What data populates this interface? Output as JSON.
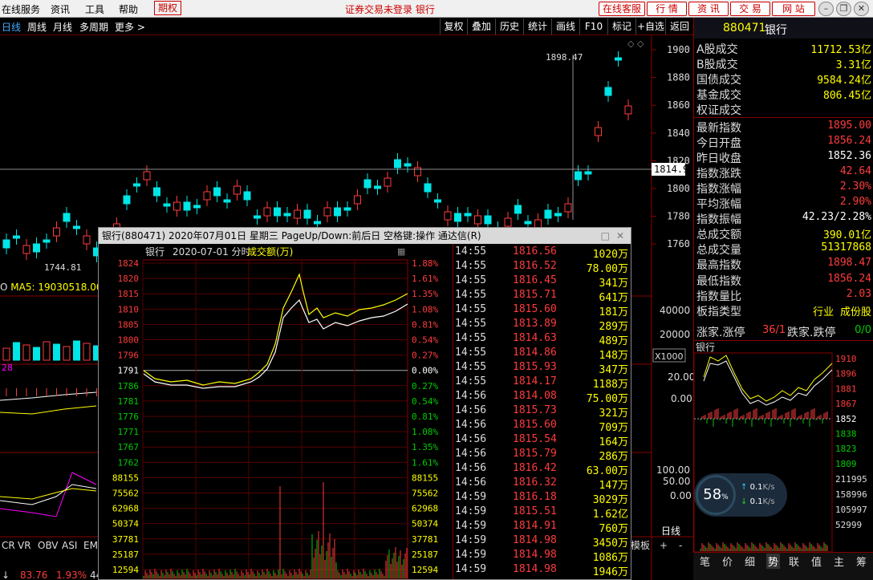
{
  "menu": {
    "items": [
      "在线服务",
      "资讯",
      "工具",
      "帮助",
      "期权"
    ],
    "center": "证券交易未登录  银行",
    "right_buttons": [
      "在线客服",
      "行 情",
      "资 讯",
      "交 易",
      "网 站"
    ]
  },
  "toolbar": {
    "left": [
      "日线",
      "周线",
      "月线",
      "多周期",
      "更多 >"
    ],
    "right": [
      "复权",
      "叠加",
      "历史",
      "统计",
      "画线",
      "F10",
      "标记",
      "+自选",
      "返回"
    ]
  },
  "main_chart": {
    "price_axis": [
      "1900",
      "1880",
      "1860",
      "1840",
      "1820",
      "1800",
      "1780",
      "1760"
    ],
    "current_price_label": "1814.9",
    "high_label": "1898.47",
    "low_label": "1744.81",
    "ma_label": "MA5: 19030518.00",
    "vol_axis": [
      "40000",
      "20000"
    ],
    "x1000_label": "X1000",
    "ind_axis": [
      "20.00",
      "0.00"
    ],
    "ind2_axis": [
      "100.00",
      "50.00",
      "0.00"
    ],
    "ind_tabs": [
      "CR",
      "VR",
      "OBV",
      "ASI",
      "EM"
    ],
    "bottom_status": [
      "83.76",
      "1.93%"
    ],
    "bottom_tabs": [
      "模板",
      "+",
      "日线",
      "-"
    ],
    "count_label": "28",
    "extra": "44"
  },
  "right_panel": {
    "code": "880471",
    "name": "银行",
    "stats": [
      {
        "k": "A股成交",
        "v": "11712.53亿",
        "c": "yel"
      },
      {
        "k": "B股成交",
        "v": "3.31亿",
        "c": "yel"
      },
      {
        "k": "国债成交",
        "v": "9584.24亿",
        "c": "yel"
      },
      {
        "k": "基金成交",
        "v": "806.45亿",
        "c": "yel"
      },
      {
        "k": "权证成交",
        "v": "",
        "c": "yel"
      },
      {
        "k": "最新指数",
        "v": "1895.00",
        "c": "red"
      },
      {
        "k": "今日开盘",
        "v": "1856.24",
        "c": "red"
      },
      {
        "k": "昨日收盘",
        "v": "1852.36",
        "c": "wht"
      },
      {
        "k": "指数涨跌",
        "v": "42.64",
        "c": "red"
      },
      {
        "k": "指数涨幅",
        "v": "2.30%",
        "c": "red"
      },
      {
        "k": "平均涨幅",
        "v": "2.90%",
        "c": "red"
      },
      {
        "k": "指数振幅",
        "v": "42.23/2.28%",
        "c": "wht"
      },
      {
        "k": "总成交额",
        "v": "390.01亿",
        "c": "yel"
      },
      {
        "k": "总成交量",
        "v": "51317868",
        "c": "yel"
      },
      {
        "k": "最高指数",
        "v": "1898.47",
        "c": "red"
      },
      {
        "k": "最低指数",
        "v": "1856.24",
        "c": "red"
      },
      {
        "k": "指数量比",
        "v": "2.03",
        "c": "red"
      },
      {
        "k": "板指类型",
        "v": "行业 成份股",
        "c": "yel"
      }
    ],
    "updown": {
      "up_label": "涨家.涨停",
      "up_val": "36/1",
      "down_label": "跌家.跌停",
      "down_val": "0/0"
    },
    "mini_title": "银行",
    "mini_axis": [
      "1910",
      "1896",
      "1881",
      "1867",
      "1852",
      "1838",
      "1823",
      "1809"
    ],
    "mini_vol_axis": [
      "211995",
      "158996",
      "105997",
      "52999"
    ],
    "net_percent": "58",
    "net_up": "0.1",
    "net_down": "0.1",
    "net_unit": "K/s",
    "bottom_tabs": [
      "笔",
      "价",
      "细",
      "势",
      "联",
      "值",
      "主",
      "筹"
    ]
  },
  "popup": {
    "title": "银行(880471)  2020年07月01日 星期三  PageUp/Down:前后日 空格键:操作 通达信(R)",
    "header_name": "银行",
    "header_date": "2020-07-01 分时",
    "header_mode": "成交额(万)",
    "left_axis": [
      "1824",
      "1820",
      "1815",
      "1810",
      "1805",
      "1800",
      "1796",
      "1791",
      "1786",
      "1781",
      "1776",
      "1771",
      "1767",
      "1762"
    ],
    "pct_axis": [
      "1.88%",
      "1.61%",
      "1.35%",
      "1.08%",
      "0.81%",
      "0.54%",
      "0.27%",
      "0.00%",
      "0.27%",
      "0.54%",
      "0.81%",
      "1.08%",
      "1.35%",
      "1.61%"
    ],
    "vol_axis": [
      "88155",
      "75562",
      "62968",
      "50374",
      "37781",
      "25187",
      "12594"
    ],
    "ticks": [
      {
        "t": "14:55",
        "p": "1816.56",
        "v": "1020万"
      },
      {
        "t": "14:55",
        "p": "1816.52",
        "v": "78.00万"
      },
      {
        "t": "14:55",
        "p": "1816.45",
        "v": "341万"
      },
      {
        "t": "14:55",
        "p": "1815.71",
        "v": "641万"
      },
      {
        "t": "14:55",
        "p": "1815.60",
        "v": "181万"
      },
      {
        "t": "14:55",
        "p": "1813.89",
        "v": "289万"
      },
      {
        "t": "14:55",
        "p": "1814.63",
        "v": "489万"
      },
      {
        "t": "14:55",
        "p": "1814.86",
        "v": "148万"
      },
      {
        "t": "14:55",
        "p": "1815.93",
        "v": "347万"
      },
      {
        "t": "14:55",
        "p": "1814.17",
        "v": "1188万"
      },
      {
        "t": "14:56",
        "p": "1814.08",
        "v": "75.00万"
      },
      {
        "t": "14:56",
        "p": "1815.73",
        "v": "321万"
      },
      {
        "t": "14:56",
        "p": "1815.60",
        "v": "709万"
      },
      {
        "t": "14:56",
        "p": "1815.54",
        "v": "164万"
      },
      {
        "t": "14:56",
        "p": "1815.79",
        "v": "286万"
      },
      {
        "t": "14:56",
        "p": "1816.42",
        "v": "63.00万"
      },
      {
        "t": "14:56",
        "p": "1816.32",
        "v": "147万"
      },
      {
        "t": "14:59",
        "p": "1816.18",
        "v": "3029万"
      },
      {
        "t": "14:59",
        "p": "1815.51",
        "v": "1.62亿"
      },
      {
        "t": "14:59",
        "p": "1814.91",
        "v": "760万"
      },
      {
        "t": "14:59",
        "p": "1814.98",
        "v": "3450万"
      },
      {
        "t": "14:59",
        "p": "1814.98",
        "v": "1086万"
      },
      {
        "t": "14:59",
        "p": "1814.98",
        "v": "1946万"
      }
    ]
  },
  "colors": {
    "up": "#ff3c3c",
    "down": "#00e5e5",
    "ma": "#ffff00",
    "panel_border": "#800000"
  }
}
